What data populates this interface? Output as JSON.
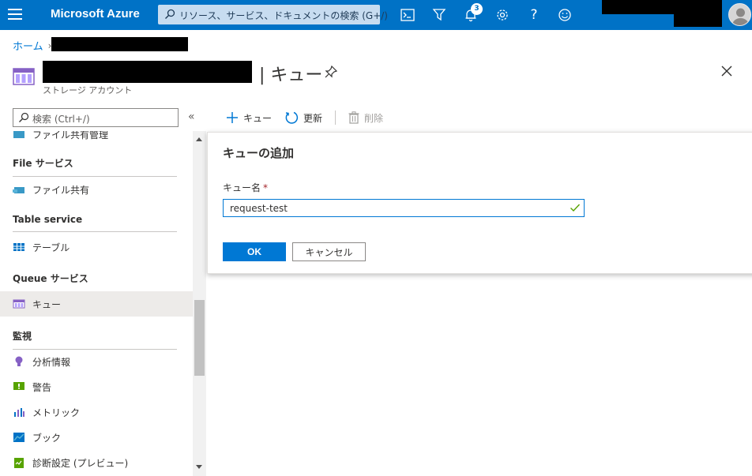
{
  "topbar": {
    "brand": "Microsoft Azure",
    "search_placeholder": "リソース、サービス、ドキュメントの検索 (G+/)",
    "notification_count": "3",
    "icons": [
      "terminal-icon",
      "directory-filter-icon",
      "bell-icon",
      "gear-icon",
      "help-icon",
      "feedback-smiley-icon"
    ],
    "accent": "#0072c6"
  },
  "breadcrumb": {
    "home": "ホーム"
  },
  "page": {
    "title": "| キュー",
    "subtitle": "ストレージ アカウント"
  },
  "nav": {
    "search_placeholder": "検索 (Ctrl+/)",
    "collapse_label": "«",
    "cutoff_item": "ファイル共有管理",
    "groups": {
      "file": "File サービス",
      "table": "Table service",
      "queue": "Queue サービス",
      "monitor": "監視"
    },
    "items": {
      "fileshare": "ファイル共有",
      "table": "テーブル",
      "queue": "キュー",
      "insights": "分析情報",
      "alerts": "警告",
      "metrics": "メトリック",
      "workbooks": "ブック",
      "diagnostics": "診断設定 (プレビュー)"
    }
  },
  "toolbar": {
    "add": "キュー",
    "refresh": "更新",
    "delete": "削除"
  },
  "dialog": {
    "title": "キューの追加",
    "field_label": "キュー名",
    "required_mark": "*",
    "field_value": "request-test",
    "ok": "OK",
    "cancel": "キャンセル"
  }
}
